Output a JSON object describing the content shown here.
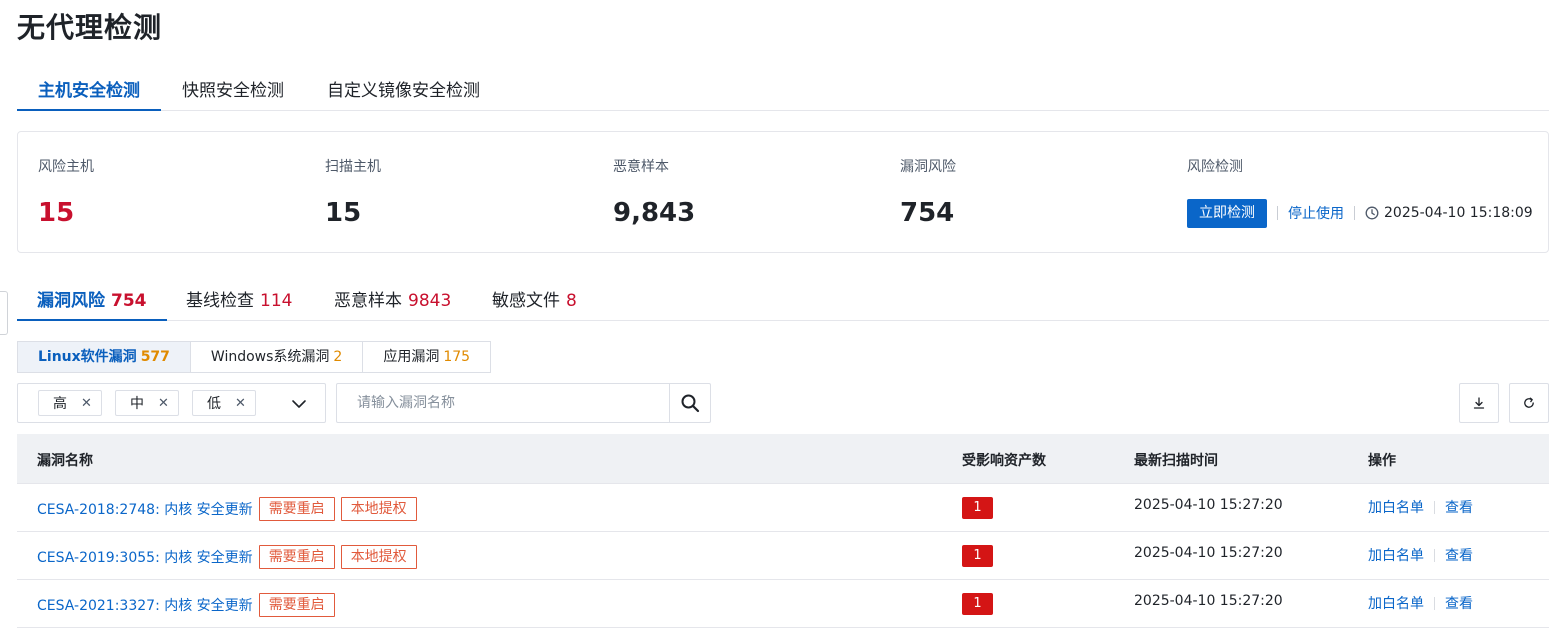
{
  "page": {
    "title": "无代理检测"
  },
  "main_tabs": [
    {
      "label": "主机安全检测",
      "active": true
    },
    {
      "label": "快照安全检测",
      "active": false
    },
    {
      "label": "自定义镜像安全检测",
      "active": false
    }
  ],
  "stats": {
    "risk_hosts": {
      "label": "风险主机",
      "value": "15"
    },
    "scan_hosts": {
      "label": "扫描主机",
      "value": "15"
    },
    "malicious_samples": {
      "label": "恶意样本",
      "value": "9,843"
    },
    "vuln_risk": {
      "label": "漏洞风险",
      "value": "754"
    },
    "risk_detect": {
      "label": "风险检测",
      "detect_button": "立即检测",
      "stop_link": "停止使用",
      "last_time": "2025-04-10 15:18:09"
    }
  },
  "sub_tabs": [
    {
      "label": "漏洞风险",
      "count": "754",
      "active": true
    },
    {
      "label": "基线检查",
      "count": "114",
      "active": false
    },
    {
      "label": "恶意样本",
      "count": "9843",
      "active": false
    },
    {
      "label": "敏感文件",
      "count": "8",
      "active": false
    }
  ],
  "segments": [
    {
      "label": "Linux软件漏洞",
      "count": "577",
      "active": true
    },
    {
      "label": "Windows系统漏洞",
      "count": "2",
      "active": false
    },
    {
      "label": "应用漏洞",
      "count": "175",
      "active": false
    }
  ],
  "filters": {
    "severity_tags": [
      "高",
      "中",
      "低"
    ],
    "search_placeholder": "请输入漏洞名称"
  },
  "table": {
    "headers": {
      "name": "漏洞名称",
      "affected": "受影响资产数",
      "last_scan": "最新扫描时间",
      "ops": "操作"
    },
    "rows": [
      {
        "name": "CESA-2018:2748: 内核 安全更新",
        "tags": [
          "需要重启",
          "本地提权"
        ],
        "affected": "1",
        "last_scan": "2025-04-10 15:27:20",
        "whitelist": "加白名单",
        "view": "查看"
      },
      {
        "name": "CESA-2019:3055: 内核 安全更新",
        "tags": [
          "需要重启",
          "本地提权"
        ],
        "affected": "1",
        "last_scan": "2025-04-10 15:27:20",
        "whitelist": "加白名单",
        "view": "查看"
      },
      {
        "name": "CESA-2021:3327: 内核 安全更新",
        "tags": [
          "需要重启"
        ],
        "affected": "1",
        "last_scan": "2025-04-10 15:27:20",
        "whitelist": "加白名单",
        "view": "查看"
      }
    ]
  },
  "colors": {
    "accent": "#0a66c9",
    "danger": "#c8102e",
    "badge_border": "#e15a3c",
    "count_orange": "#e08a00"
  },
  "icons": [
    "clock-icon",
    "close-icon",
    "chevron-down-icon",
    "search-icon",
    "download-icon",
    "refresh-icon"
  ]
}
